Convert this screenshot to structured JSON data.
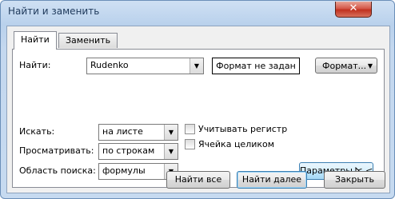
{
  "window": {
    "title": "Найти и заменить",
    "close_glyph": "✕"
  },
  "tabs": [
    {
      "label": "Найти",
      "active": true
    },
    {
      "label": "Заменить",
      "active": false
    }
  ],
  "find": {
    "label": "Найти:",
    "value": "Rudenko",
    "format_status": "Формат не задан",
    "format_button": "Формат...",
    "format_arrow": "▼"
  },
  "options": {
    "within": {
      "label": "Искать:",
      "value": "на листе"
    },
    "search": {
      "label": "Просматривать:",
      "value": "по строкам"
    },
    "look_in": {
      "label": "Область поиска:",
      "value": "формулы"
    },
    "match_case": {
      "label": "Учитывать регистр",
      "checked": false
    },
    "match_entire": {
      "label": "Ячейка целиком",
      "checked": false
    },
    "params_button": "Параметры < <"
  },
  "buttons": {
    "find_all": "Найти все",
    "find_next": "Найти далее",
    "close": "Закрыть"
  },
  "icons": {
    "dropdown": "chevron-down-icon",
    "cursor": "mouse-pointer-icon"
  }
}
